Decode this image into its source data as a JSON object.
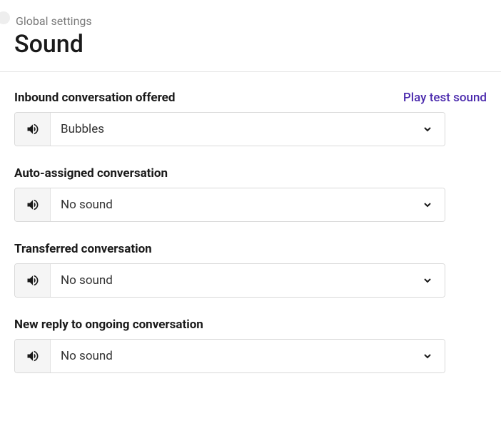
{
  "header": {
    "breadcrumb": "Global settings",
    "title": "Sound"
  },
  "actions": {
    "play_test_sound": "Play test sound"
  },
  "settings": [
    {
      "id": "inbound",
      "label": "Inbound conversation offered",
      "value": "Bubbles",
      "show_play": true
    },
    {
      "id": "auto-assigned",
      "label": "Auto-assigned conversation",
      "value": "No sound",
      "show_play": false
    },
    {
      "id": "transferred",
      "label": "Transferred conversation",
      "value": "No sound",
      "show_play": false
    },
    {
      "id": "new-reply",
      "label": "New reply to ongoing conversation",
      "value": "No sound",
      "show_play": false
    }
  ]
}
